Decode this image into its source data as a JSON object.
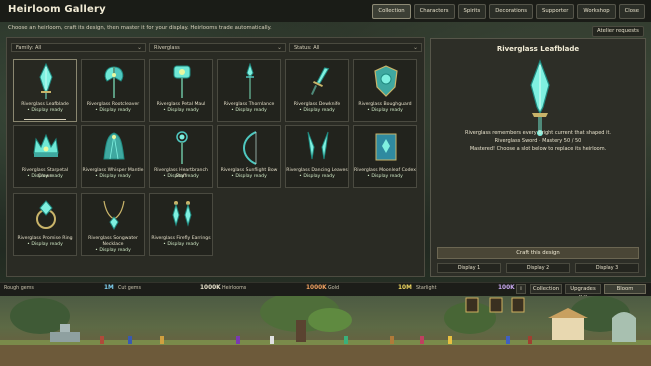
{
  "header": {
    "title": "Heirloom Gallery",
    "subtitle": "Choose an heirloom, craft its design, then master it for your display. Heirlooms trade automatically.",
    "tabs": [
      {
        "label": "Collection",
        "active": true
      },
      {
        "label": "Characters",
        "active": false
      },
      {
        "label": "Spirits",
        "active": false
      },
      {
        "label": "Decorations",
        "active": false
      },
      {
        "label": "Supporter",
        "active": false
      },
      {
        "label": "Workshop",
        "active": false
      },
      {
        "label": "Close",
        "active": false
      }
    ],
    "atelier_label": "Atelier requests"
  },
  "filters": {
    "family": "Family: All",
    "material": "Riverglass",
    "status": "Status: All"
  },
  "cards": [
    {
      "name": "Riverglass Leafblade",
      "status": "• Display ready",
      "icon": "leafblade-icon",
      "selected": true
    },
    {
      "name": "Riverglass Rootcleaver",
      "status": "• Display ready",
      "icon": "axe-icon"
    },
    {
      "name": "Riverglass Petal Maul",
      "status": "• Display ready",
      "icon": "maul-icon"
    },
    {
      "name": "Riverglass Thornlance",
      "status": "• Display ready",
      "icon": "lance-icon"
    },
    {
      "name": "Riverglass Dewknife",
      "status": "• Display ready",
      "icon": "dagger-icon"
    },
    {
      "name": "Riverglass Boughguard",
      "status": "• Display ready",
      "icon": "shield-icon"
    },
    {
      "name": "Riverglass Starpetal Crown",
      "status": "• Display ready",
      "icon": "crown-icon"
    },
    {
      "name": "Riverglass Whisper Mantle",
      "status": "• Display ready",
      "icon": "mantle-icon"
    },
    {
      "name": "Riverglass Heartbranch Staff",
      "status": "• Display ready",
      "icon": "staff-icon"
    },
    {
      "name": "Riverglass Sunflight Bow",
      "status": "• Display ready",
      "icon": "bow-icon"
    },
    {
      "name": "Riverglass Dancing Leaves",
      "status": "• Display ready",
      "icon": "twin-blades-icon"
    },
    {
      "name": "Riverglass Moonleaf Codex",
      "status": "• Display ready",
      "icon": "codex-icon"
    },
    {
      "name": "Riverglass Promise Ring",
      "status": "• Display ready",
      "icon": "ring-icon"
    },
    {
      "name": "Riverglass Songwater Necklace",
      "status": "• Display ready",
      "icon": "necklace-icon"
    },
    {
      "name": "Riverglass Firefly Earrings",
      "status": "• Display ready",
      "icon": "earrings-icon"
    }
  ],
  "detail": {
    "title": "Riverglass Leafblade",
    "line1": "Riverglass remembers every bright current that shaped it.",
    "line2": "Riverglass Sword · Mastery 50 / 50",
    "line3": "Mastered! Choose a slot below to replace its heirloom.",
    "craft_label": "Craft this design",
    "slots": [
      "Display 1",
      "Display 2",
      "Display 3"
    ],
    "icon": "leafblade-icon"
  },
  "resources": [
    {
      "label": "Rough gems",
      "value": "1M",
      "value_label": "Cut gems",
      "color": "#7fd0f0"
    },
    {
      "label": "",
      "value": "1000K",
      "value_label": "Heirlooms",
      "color": "#e8e2cc"
    },
    {
      "label": "",
      "value": "1000K",
      "value_label": "Gold",
      "color": "#f0a060"
    },
    {
      "label": "",
      "value": "10M",
      "value_label": "Starlight",
      "color": "#f0d860"
    },
    {
      "label": "",
      "value": "100K",
      "value_label": "",
      "color": "#c8a8f0"
    }
  ],
  "bottom_buttons": {
    "info": "i",
    "collection": "Collection",
    "upgrades": "Upgrades [U]",
    "bloom": "Bloom"
  },
  "colors": {
    "accent_text": "#cfe8c5",
    "crystal": "#5fd6c8",
    "panel": "#2a2b24"
  }
}
